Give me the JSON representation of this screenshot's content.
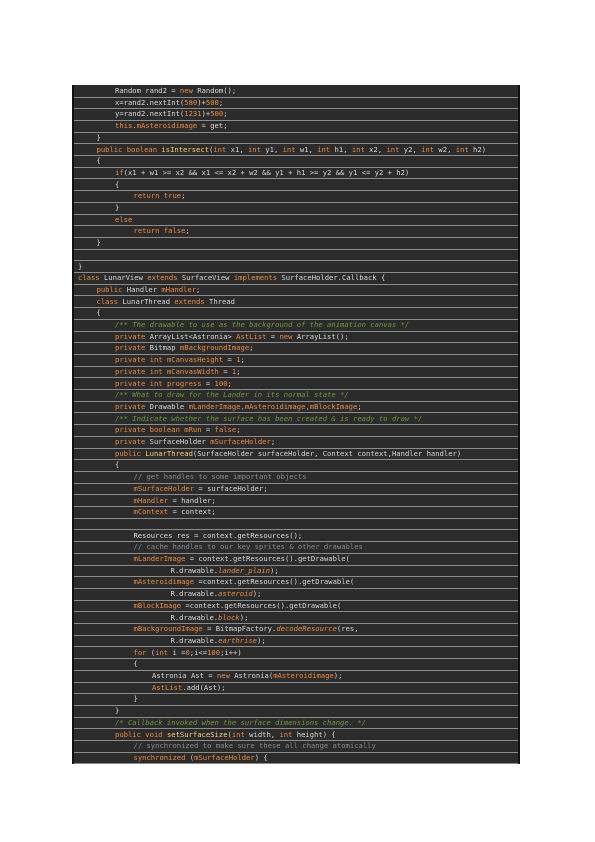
{
  "code_lines": [
    {
      "indent": 2,
      "spans": [
        [
          "t",
          "Random rand2 = "
        ],
        [
          "k",
          "new"
        ],
        [
          "t",
          " Random();"
        ]
      ]
    },
    {
      "indent": 2,
      "spans": [
        [
          "t",
          "x=rand2.nextInt("
        ],
        [
          "n",
          "580"
        ],
        [
          "t",
          ")+"
        ],
        [
          "n",
          "500"
        ],
        [
          "t",
          ";"
        ]
      ]
    },
    {
      "indent": 2,
      "spans": [
        [
          "t",
          "y=rand2.nextInt("
        ],
        [
          "n",
          "1231"
        ],
        [
          "t",
          ")+"
        ],
        [
          "n",
          "500"
        ],
        [
          "t",
          ";"
        ]
      ]
    },
    {
      "indent": 2,
      "spans": [
        [
          "k",
          "this"
        ],
        [
          "t",
          "."
        ],
        [
          "f",
          "mAsteroidimage"
        ],
        [
          "t",
          " = get;"
        ]
      ]
    },
    {
      "indent": 1,
      "spans": [
        [
          "t",
          "}"
        ]
      ]
    },
    {
      "indent": 1,
      "spans": [
        [
          "k",
          "public boolean"
        ],
        [
          "t",
          " "
        ],
        [
          "fn",
          "isIntersect"
        ],
        [
          "t",
          "("
        ],
        [
          "k",
          "int"
        ],
        [
          "t",
          " x1, "
        ],
        [
          "k",
          "int"
        ],
        [
          "t",
          " y1, "
        ],
        [
          "k",
          "int"
        ],
        [
          "t",
          " w1, "
        ],
        [
          "k",
          "int"
        ],
        [
          "t",
          " h1, "
        ],
        [
          "k",
          "int"
        ],
        [
          "t",
          " x2, "
        ],
        [
          "k",
          "int"
        ],
        [
          "t",
          " y2, "
        ],
        [
          "k",
          "int"
        ],
        [
          "t",
          " w2, "
        ],
        [
          "k",
          "int"
        ],
        [
          "t",
          " h2)"
        ]
      ]
    },
    {
      "indent": 1,
      "spans": [
        [
          "t",
          "{"
        ]
      ]
    },
    {
      "indent": 2,
      "spans": [
        [
          "k",
          "if"
        ],
        [
          "t",
          "(x1 + w1 >= x2 && x1 <= x2 + w2 && y1 + h1 >= y2 && y1 <= y2 + h2)"
        ]
      ]
    },
    {
      "indent": 2,
      "spans": [
        [
          "t",
          "{"
        ]
      ]
    },
    {
      "indent": 3,
      "spans": [
        [
          "k",
          "return true"
        ],
        [
          "t",
          ";"
        ]
      ]
    },
    {
      "indent": 2,
      "spans": [
        [
          "t",
          "}"
        ]
      ]
    },
    {
      "indent": 2,
      "spans": [
        [
          "k",
          "else"
        ]
      ]
    },
    {
      "indent": 3,
      "spans": [
        [
          "k",
          "return false"
        ],
        [
          "t",
          ";"
        ]
      ]
    },
    {
      "indent": 1,
      "spans": [
        [
          "t",
          "}"
        ]
      ]
    },
    {
      "indent": 0,
      "spans": []
    },
    {
      "indent": 0,
      "spans": [
        [
          "t",
          "}"
        ]
      ]
    },
    {
      "indent": 0,
      "spans": [
        [
          "k",
          "class"
        ],
        [
          "t",
          " LunarView "
        ],
        [
          "k",
          "extends"
        ],
        [
          "t",
          " SurfaceView "
        ],
        [
          "k",
          "implements"
        ],
        [
          "t",
          " SurfaceHolder.Callback {"
        ]
      ]
    },
    {
      "indent": 1,
      "spans": [
        [
          "k",
          "public"
        ],
        [
          "t",
          " Handler "
        ],
        [
          "f",
          "mHandler"
        ],
        [
          "t",
          ";"
        ]
      ]
    },
    {
      "indent": 1,
      "spans": [
        [
          "k",
          "class"
        ],
        [
          "t",
          " LunarThread "
        ],
        [
          "k",
          "extends"
        ],
        [
          "t",
          " Thread"
        ]
      ]
    },
    {
      "indent": 1,
      "spans": [
        [
          "t",
          "{"
        ]
      ]
    },
    {
      "indent": 2,
      "spans": [
        [
          "c",
          "/** The drawable to use as the background of the animation canvas */"
        ]
      ]
    },
    {
      "indent": 2,
      "spans": [
        [
          "k",
          "private"
        ],
        [
          "t",
          " ArrayList<Astronia> "
        ],
        [
          "f",
          "AstList"
        ],
        [
          "t",
          " = "
        ],
        [
          "k",
          "new"
        ],
        [
          "t",
          " ArrayList();"
        ]
      ]
    },
    {
      "indent": 2,
      "spans": [
        [
          "k",
          "private"
        ],
        [
          "t",
          " Bitmap "
        ],
        [
          "f",
          "mBackgroundImage"
        ],
        [
          "t",
          ";"
        ]
      ]
    },
    {
      "indent": 2,
      "spans": [
        [
          "k",
          "private int"
        ],
        [
          "t",
          " "
        ],
        [
          "f",
          "mCanvasHeight"
        ],
        [
          "t",
          " = "
        ],
        [
          "n",
          "1"
        ],
        [
          "t",
          ";"
        ]
      ]
    },
    {
      "indent": 2,
      "spans": [
        [
          "k",
          "private int"
        ],
        [
          "t",
          " "
        ],
        [
          "f",
          "mCanvasWidth"
        ],
        [
          "t",
          " = "
        ],
        [
          "n",
          "1"
        ],
        [
          "t",
          ";"
        ]
      ]
    },
    {
      "indent": 2,
      "spans": [
        [
          "k",
          "private int"
        ],
        [
          "t",
          " "
        ],
        [
          "f",
          "progress"
        ],
        [
          "t",
          " = "
        ],
        [
          "n",
          "100"
        ],
        [
          "t",
          ";"
        ]
      ]
    },
    {
      "indent": 2,
      "spans": [
        [
          "c",
          "/** What to draw for the Lander in its normal state */"
        ]
      ]
    },
    {
      "indent": 2,
      "spans": [
        [
          "k",
          "private"
        ],
        [
          "t",
          " Drawable "
        ],
        [
          "f",
          "mLanderImage,mAsteroidimage,mBlockImage"
        ],
        [
          "t",
          ";"
        ]
      ]
    },
    {
      "indent": 2,
      "spans": [
        [
          "c",
          "/** Indicate whether the surface has been created & is ready to draw */"
        ]
      ]
    },
    {
      "indent": 2,
      "spans": [
        [
          "k",
          "private boolean"
        ],
        [
          "t",
          " "
        ],
        [
          "f",
          "mRun"
        ],
        [
          "t",
          " = "
        ],
        [
          "k",
          "false"
        ],
        [
          "t",
          ";"
        ]
      ]
    },
    {
      "indent": 2,
      "spans": [
        [
          "k",
          "private"
        ],
        [
          "t",
          " SurfaceHolder "
        ],
        [
          "f",
          "mSurfaceHolder"
        ],
        [
          "t",
          ";"
        ]
      ]
    },
    {
      "indent": 2,
      "spans": [
        [
          "k",
          "public"
        ],
        [
          "t",
          " "
        ],
        [
          "fn",
          "LunarThread"
        ],
        [
          "t",
          "(SurfaceHolder surfaceHolder, Context context,Handler handler)"
        ]
      ]
    },
    {
      "indent": 2,
      "spans": [
        [
          "t",
          "{"
        ]
      ]
    },
    {
      "indent": 3,
      "spans": [
        [
          "p",
          "// get handles to some important objects"
        ]
      ]
    },
    {
      "indent": 3,
      "spans": [
        [
          "f",
          "mSurfaceHolder"
        ],
        [
          "t",
          " = surfaceHolder;"
        ]
      ]
    },
    {
      "indent": 3,
      "spans": [
        [
          "f",
          "mHandler"
        ],
        [
          "t",
          " = handler;"
        ]
      ]
    },
    {
      "indent": 3,
      "spans": [
        [
          "f",
          "mContext"
        ],
        [
          "t",
          " = context;"
        ]
      ]
    },
    {
      "indent": 0,
      "spans": []
    },
    {
      "indent": 3,
      "spans": [
        [
          "t",
          "Resources res = context.getResources();"
        ]
      ]
    },
    {
      "indent": 3,
      "spans": [
        [
          "p",
          "// cache handles to our key sprites & other drawables"
        ]
      ]
    },
    {
      "indent": 3,
      "spans": [
        [
          "f",
          "mLanderImage"
        ],
        [
          "t",
          " = context.getResources().getDrawable("
        ]
      ]
    },
    {
      "indent": 5,
      "spans": [
        [
          "t",
          "R.drawable."
        ],
        [
          "i",
          "lander_plain"
        ],
        [
          "t",
          ");"
        ]
      ]
    },
    {
      "indent": 3,
      "spans": [
        [
          "f",
          "mAsteroidimage"
        ],
        [
          "t",
          " =context.getResources().getDrawable("
        ]
      ]
    },
    {
      "indent": 5,
      "spans": [
        [
          "t",
          "R.drawable."
        ],
        [
          "i",
          "asteroid"
        ],
        [
          "t",
          ");"
        ]
      ]
    },
    {
      "indent": 3,
      "spans": [
        [
          "f",
          "mBlockImage"
        ],
        [
          "t",
          " =context.getResources().getDrawable("
        ]
      ]
    },
    {
      "indent": 5,
      "spans": [
        [
          "t",
          "R.drawable."
        ],
        [
          "i",
          "block"
        ],
        [
          "t",
          ");"
        ]
      ]
    },
    {
      "indent": 3,
      "spans": [
        [
          "f",
          "mBackgroundImage"
        ],
        [
          "t",
          " = BitmapFactory."
        ],
        [
          "i",
          "decodeResource"
        ],
        [
          "t",
          "(res,"
        ]
      ]
    },
    {
      "indent": 5,
      "spans": [
        [
          "t",
          "R.drawable."
        ],
        [
          "i",
          "earthrise"
        ],
        [
          "t",
          ");"
        ]
      ]
    },
    {
      "indent": 3,
      "spans": [
        [
          "k",
          "for"
        ],
        [
          "t",
          " ("
        ],
        [
          "k",
          "int"
        ],
        [
          "t",
          " i ="
        ],
        [
          "n",
          "0"
        ],
        [
          "t",
          ";i<="
        ],
        [
          "n",
          "100"
        ],
        [
          "t",
          ";i++)"
        ]
      ]
    },
    {
      "indent": 3,
      "spans": [
        [
          "t",
          "{"
        ]
      ]
    },
    {
      "indent": 4,
      "spans": [
        [
          "t",
          "Astronia Ast = "
        ],
        [
          "k",
          "new"
        ],
        [
          "t",
          " Astronia("
        ],
        [
          "f",
          "mAsteroidimage"
        ],
        [
          "t",
          ");"
        ]
      ]
    },
    {
      "indent": 4,
      "spans": [
        [
          "f",
          "AstList"
        ],
        [
          "t",
          ".add(Ast);"
        ]
      ]
    },
    {
      "indent": 3,
      "spans": [
        [
          "t",
          "}"
        ]
      ]
    },
    {
      "indent": 2,
      "spans": [
        [
          "t",
          "}"
        ]
      ]
    },
    {
      "indent": 2,
      "spans": [
        [
          "c",
          "/* Callback invoked when the surface dimensions change. */"
        ]
      ]
    },
    {
      "indent": 2,
      "spans": [
        [
          "k",
          "public void"
        ],
        [
          "t",
          " "
        ],
        [
          "fn",
          "setSurfaceSize"
        ],
        [
          "t",
          "("
        ],
        [
          "k",
          "int"
        ],
        [
          "t",
          " width, "
        ],
        [
          "k",
          "int"
        ],
        [
          "t",
          " height) {"
        ]
      ]
    },
    {
      "indent": 3,
      "spans": [
        [
          "p",
          "// synchronized to make sure these all change atomically"
        ]
      ]
    },
    {
      "indent": 3,
      "spans": [
        [
          "k",
          "synchronized"
        ],
        [
          "t",
          " ("
        ],
        [
          "f",
          "mSurfaceHolder"
        ],
        [
          "t",
          ") {"
        ]
      ]
    }
  ]
}
